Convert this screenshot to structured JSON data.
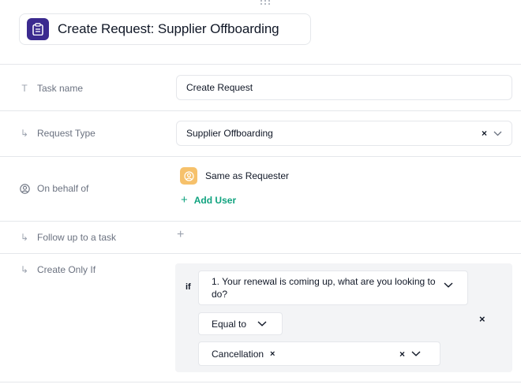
{
  "header": {
    "title": "Create Request: Supplier Offboarding",
    "icon": "clipboard-icon",
    "icon_bg": "#3b2a8f"
  },
  "fields": {
    "task_name": {
      "label": "Task name",
      "value": "Create Request"
    },
    "request_type": {
      "label": "Request Type",
      "value": "Supplier Offboarding"
    },
    "on_behalf_of": {
      "label": "On behalf of",
      "person": "Same as Requester",
      "add_user": "Add User"
    },
    "follow_up": {
      "label": "Follow up to a task"
    },
    "create_only_if": {
      "label": "Create Only If",
      "if_label": "if",
      "question": "1. Your renewal is coming up, what are you looking to do?",
      "operator": "Equal to",
      "value_tag": "Cancellation"
    }
  },
  "colors": {
    "accent_green": "#10a37f",
    "avatar_bg": "#f6c16b"
  }
}
